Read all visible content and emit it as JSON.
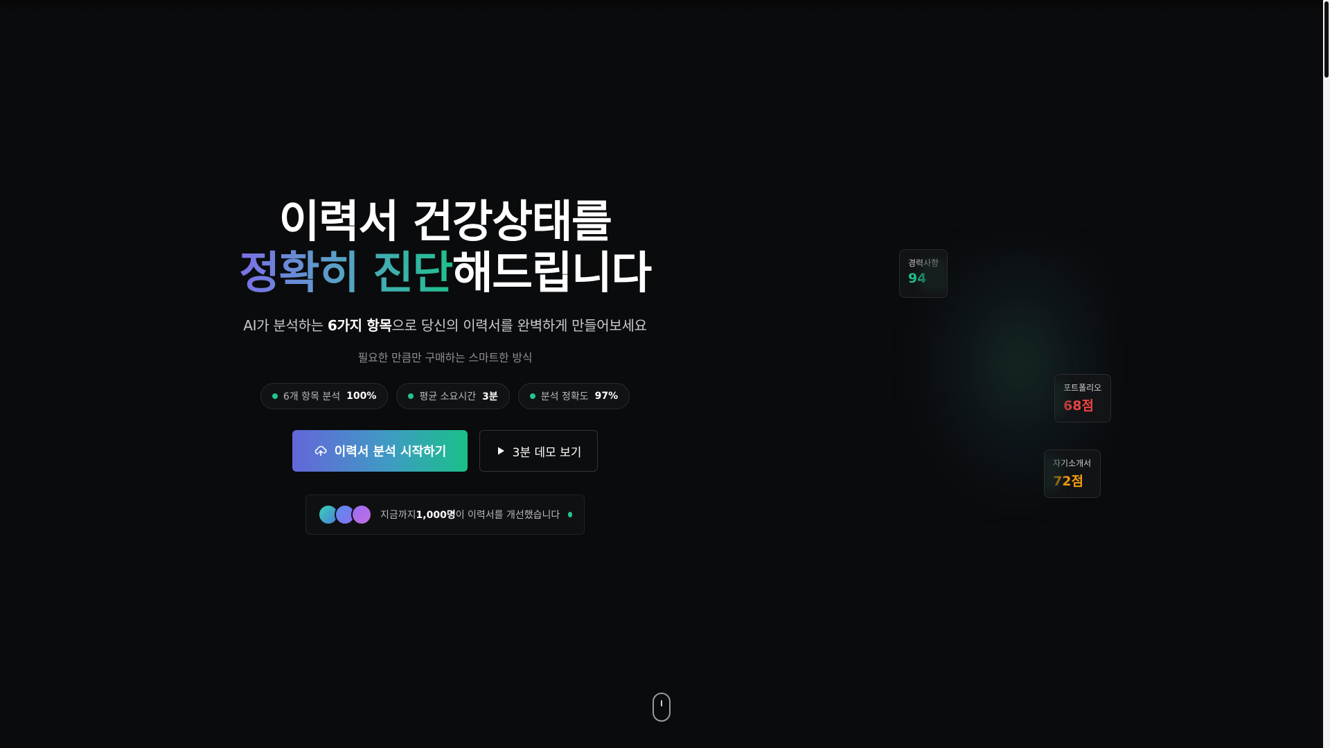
{
  "hero": {
    "headline_line1": "이력서 건강상태를",
    "headline_line2_gradient": "정확히 진단",
    "headline_line2_rest": "해드립니다",
    "subtitle_pre": "AI가 분석하는 ",
    "subtitle_bold": "6가지 항목",
    "subtitle_post": "으로 당신의 이력서를 완벽하게 만들어보세요",
    "subnote": "필요한 만큼만 구매하는 스마트한 방식"
  },
  "stats": [
    {
      "label": "6개 항목 분석",
      "value": "100%"
    },
    {
      "label": "평균 소요시간",
      "value": "3분"
    },
    {
      "label": "분석 정확도",
      "value": "97%"
    }
  ],
  "actions": {
    "primary_label": "이력서 분석 시작하기",
    "primary_icon": "upload-cloud-icon",
    "secondary_label": "3분 데모 보기",
    "secondary_icon": "play-icon"
  },
  "social_proof": {
    "pre": "지금까지 ",
    "bold": "1,000명",
    "post": "이 이력서를 개선했습니다"
  },
  "score_cards": [
    {
      "label": "경력사항",
      "score": "94",
      "color": "#1fc08e"
    },
    {
      "label": "포트폴리오",
      "score": "68점",
      "color": "#ef4444"
    },
    {
      "label": "자기소개서",
      "score": "72점",
      "color": "#f59e0b"
    }
  ],
  "colors": {
    "accent_purple": "#6466d9",
    "accent_green": "#1fc08e",
    "background": "#0a0b0c"
  }
}
